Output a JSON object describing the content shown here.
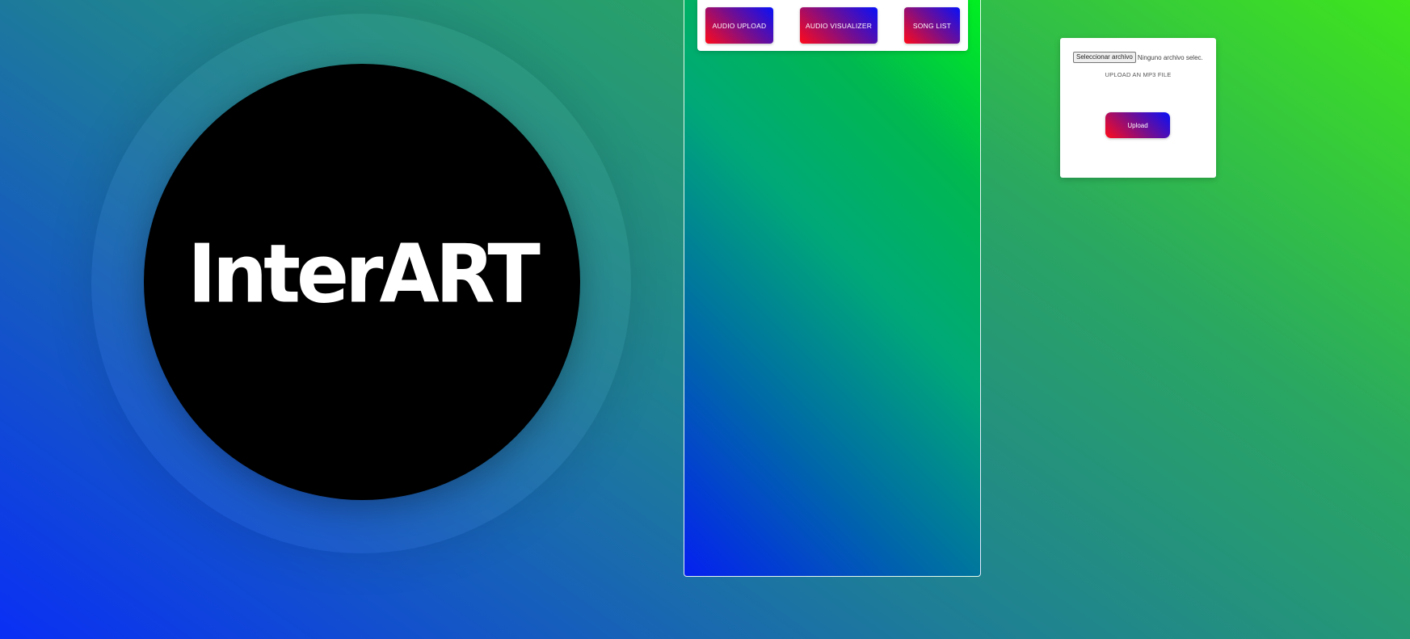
{
  "logo": {
    "text": "InterART"
  },
  "nav": {
    "items": [
      {
        "label": "AUDIO UPLOAD"
      },
      {
        "label": "AUDIO VISUALIZER"
      },
      {
        "label": "SONG LIST"
      }
    ]
  },
  "upload": {
    "file_button_label": "Seleccionar archivo",
    "file_status": "Ninguno archivo selec.",
    "label": "UPLOAD AN MP3 FILE",
    "submit_label": "Upload"
  },
  "colors": {
    "button_gradient_start": "#ff0a1a",
    "button_gradient_end": "#0810f8",
    "background_top_right": "#3fe61c",
    "background_bottom_left": "#0a2ff5",
    "logo_background": "#000000",
    "logo_text": "#ffffff"
  }
}
